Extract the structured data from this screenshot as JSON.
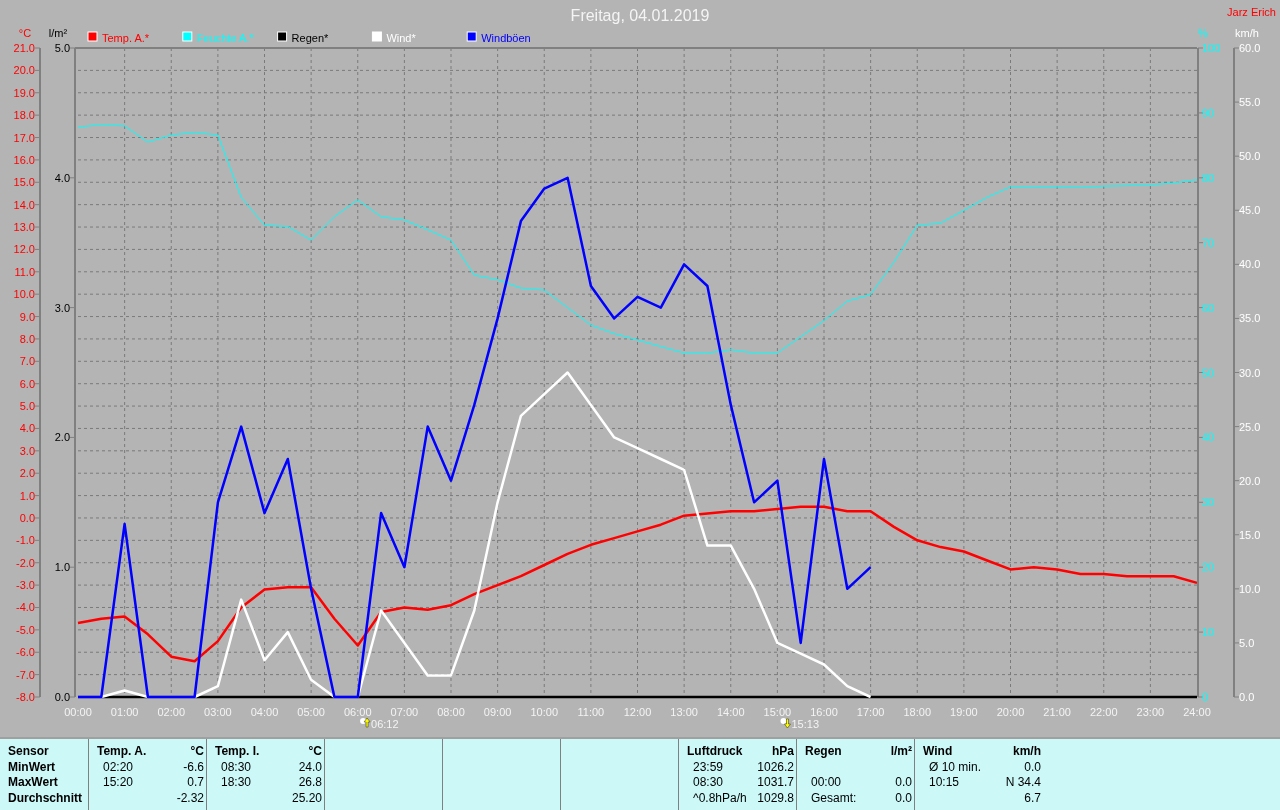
{
  "header": {
    "title": "Freitag, 04.01.2019",
    "author": "Jarz Erich"
  },
  "charts": [
    {
      "chart_data": {
        "type": "line",
        "ylabel": "°C",
        "legend": "top",
        "grid": true,
        "xlim": [
          0,
          24
        ],
        "ylim": [
          -8,
          21
        ],
        "x": [
          0,
          0.5,
          1,
          1.5,
          2,
          2.5,
          3,
          3.5,
          4,
          4.5,
          5,
          5.5,
          6,
          6.5,
          7,
          7.5,
          8,
          8.5,
          9,
          9.5,
          10,
          10.5,
          11,
          11.5,
          12,
          12.5,
          13,
          13.5,
          14,
          14.5,
          15,
          15.5,
          16,
          16.5,
          17,
          17.5,
          18,
          18.5,
          19,
          19.5,
          20,
          20.5,
          21,
          21.5,
          22,
          22.5,
          23,
          23.5,
          24
        ],
        "xticks": [
          {
            "value": 0,
            "label": "00:00"
          },
          {
            "value": 1,
            "label": "01:00"
          },
          {
            "value": 2,
            "label": "02:00"
          },
          {
            "value": 3,
            "label": "03:00"
          },
          {
            "value": 4,
            "label": "04:00"
          },
          {
            "value": 5,
            "label": "05:00"
          },
          {
            "value": 6,
            "label": "06:00"
          },
          {
            "value": 7,
            "label": "07:00"
          },
          {
            "value": 8,
            "label": "08:00"
          },
          {
            "value": 9,
            "label": "09:00"
          },
          {
            "value": 10,
            "label": "10:00"
          },
          {
            "value": 11,
            "label": "11:00"
          },
          {
            "value": 12,
            "label": "12:00"
          },
          {
            "value": 13,
            "label": "13:00"
          },
          {
            "value": 14,
            "label": "14:00"
          },
          {
            "value": 15,
            "label": "15:00"
          },
          {
            "value": 16,
            "label": "16:00"
          },
          {
            "value": 17,
            "label": "17:00"
          },
          {
            "value": 18,
            "label": "18:00"
          },
          {
            "value": 19,
            "label": "19:00"
          },
          {
            "value": 20,
            "label": "20:00"
          },
          {
            "value": 21,
            "label": "21:00"
          },
          {
            "value": 22,
            "label": "22:00"
          },
          {
            "value": 23,
            "label": "23:00"
          },
          {
            "value": 24,
            "label": "24:00"
          }
        ],
        "yticks": [
          {
            "value": 21,
            "label": "21.0"
          },
          {
            "value": 20,
            "label": "20.0"
          },
          {
            "value": 19,
            "label": "19.0"
          },
          {
            "value": 18,
            "label": "18.0"
          },
          {
            "value": 17,
            "label": "17.0"
          },
          {
            "value": 16,
            "label": "16.0"
          },
          {
            "value": 15,
            "label": "15.0"
          },
          {
            "value": 14,
            "label": "14.0"
          },
          {
            "value": 13,
            "label": "13.0"
          },
          {
            "value": 12,
            "label": "12.0"
          },
          {
            "value": 11,
            "label": "11.0"
          },
          {
            "value": 10,
            "label": "10.0"
          },
          {
            "value": 9,
            "label": "9.0"
          },
          {
            "value": 8,
            "label": "8.0"
          },
          {
            "value": 7,
            "label": "7.0"
          },
          {
            "value": 6,
            "label": "6.0"
          },
          {
            "value": 5,
            "label": "5.0"
          },
          {
            "value": 4,
            "label": "4.0"
          },
          {
            "value": 3,
            "label": "3.0"
          },
          {
            "value": 2,
            "label": "2.0"
          },
          {
            "value": 1,
            "label": "1.0"
          },
          {
            "value": 0,
            "label": "0.0"
          },
          {
            "value": -1,
            "label": "-1.0"
          },
          {
            "value": -2,
            "label": "-2.0"
          },
          {
            "value": -3,
            "label": "-3.0"
          },
          {
            "value": -4,
            "label": "-4.0"
          },
          {
            "value": -5,
            "label": "-5.0"
          },
          {
            "value": -6,
            "label": "-6.0"
          },
          {
            "value": -7,
            "label": "-7.0"
          },
          {
            "value": -8,
            "label": "-8.0"
          }
        ],
        "series": [
          {
            "name": "Temp. A.*",
            "color": "#ff0000",
            "values": [
              -4.7,
              -4.5,
              -4.4,
              -5.2,
              -6.2,
              -6.4,
              -5.5,
              -4,
              -3.2,
              -3.1,
              -3.1,
              -4.5,
              -5.7,
              -4.2,
              -4,
              -4.1,
              -3.9,
              -3.4,
              -3,
              -2.6,
              -2.1,
              -1.6,
              -1.2,
              -0.9,
              -0.6,
              -0.3,
              0.1,
              0.2,
              0.3,
              0.3,
              0.4,
              0.5,
              0.5,
              0.3,
              0.3,
              -0.4,
              -1,
              -1.3,
              -1.5,
              -1.9,
              -2.3,
              -2.2,
              -2.3,
              -2.5,
              -2.5,
              -2.6,
              -2.6,
              -2.6,
              -2.9
            ]
          }
        ]
      },
      "sun_events": [
        {
          "kind": "sunrise",
          "time": "06:12"
        },
        {
          "kind": "sunset",
          "time": "15:13"
        }
      ]
    },
    {
      "chart_data": {
        "type": "line",
        "ylabel": "%",
        "legend": "top",
        "xlim": [
          0,
          24
        ],
        "ylim": [
          0,
          100
        ],
        "x": [
          0,
          0.5,
          1,
          1.5,
          2,
          2.5,
          3,
          3.5,
          4,
          4.5,
          5,
          5.5,
          6,
          6.5,
          7,
          7.5,
          8,
          8.5,
          9,
          9.5,
          10,
          10.5,
          11,
          11.5,
          12,
          12.5,
          13,
          13.5,
          14,
          14.5,
          15,
          15.5,
          16,
          16.5,
          17,
          17.5,
          18,
          18.5,
          19,
          19.5,
          20,
          20.5,
          21,
          21.5,
          22,
          22.5,
          23,
          23.5,
          24
        ],
        "yticks": [
          {
            "value": 100,
            "label": "100"
          },
          {
            "value": 90,
            "label": "90"
          },
          {
            "value": 80,
            "label": "80"
          },
          {
            "value": 70,
            "label": "70"
          },
          {
            "value": 60,
            "label": "60"
          },
          {
            "value": 50,
            "label": "50"
          },
          {
            "value": 40,
            "label": "40"
          },
          {
            "value": 30,
            "label": "30"
          },
          {
            "value": 20,
            "label": "20"
          },
          {
            "value": 10,
            "label": "10"
          },
          {
            "value": 0,
            "label": "0"
          }
        ],
        "series": [
          {
            "name": "Feuchte A.*",
            "color": "#00ffff",
            "values": [
              87.8,
              88.2,
              88,
              85.5,
              86.6,
              87,
              86.6,
              77,
              72.7,
              72.5,
              70.4,
              74,
              76.6,
              74,
              73.5,
              72,
              70.4,
              65,
              64.3,
              63,
              62.7,
              60,
              57.3,
              56,
              55,
              54,
              53,
              53,
              53.5,
              53,
              53,
              55.5,
              58,
              61,
              62,
              67,
              72.7,
              73,
              75,
              77,
              78.6,
              78.5,
              78.6,
              78.5,
              78.7,
              78.8,
              78.9,
              79.2,
              79.7
            ]
          }
        ]
      }
    },
    {
      "chart_data": {
        "type": "line",
        "ylabel": "l/m²",
        "legend": "top",
        "xlim": [
          0,
          24
        ],
        "ylim": [
          0,
          5
        ],
        "x": [
          0,
          0.5,
          1,
          1.5,
          2,
          2.5,
          3,
          3.5,
          4,
          4.5,
          5,
          5.5,
          6,
          6.5,
          7,
          7.5,
          8,
          8.5,
          9,
          9.5,
          10,
          10.5,
          11,
          11.5,
          12,
          12.5,
          13,
          13.5,
          14,
          14.5,
          15,
          15.5,
          16,
          16.5,
          17,
          17.5,
          18,
          18.5,
          19,
          19.5,
          20,
          20.5,
          21,
          21.5,
          22,
          22.5,
          23,
          23.5,
          24
        ],
        "yticks": [
          {
            "value": 5,
            "label": "5.0"
          },
          {
            "value": 4,
            "label": "4.0"
          },
          {
            "value": 3,
            "label": "3.0"
          },
          {
            "value": 2,
            "label": "2.0"
          },
          {
            "value": 1,
            "label": "1.0"
          },
          {
            "value": 0,
            "label": "0.0"
          }
        ],
        "series": [
          {
            "name": "Regen*",
            "color": "#000000",
            "values": [
              0,
              0,
              0,
              0,
              0,
              0,
              0,
              0,
              0,
              0,
              0,
              0,
              0,
              0,
              0,
              0,
              0,
              0,
              0,
              0,
              0,
              0,
              0,
              0,
              0,
              0,
              0,
              0,
              0,
              0,
              0,
              0,
              0,
              0,
              0,
              0,
              0,
              0,
              0,
              0,
              0,
              0,
              0,
              0,
              0,
              0,
              0,
              0,
              0
            ]
          }
        ]
      }
    },
    {
      "chart_data": {
        "type": "line",
        "ylabel": "km/h",
        "legend": "top",
        "xlim": [
          0,
          24
        ],
        "ylim": [
          0,
          60
        ],
        "x": [
          0,
          0.5,
          1,
          1.5,
          2,
          2.5,
          3,
          3.5,
          4,
          4.5,
          5,
          5.5,
          6,
          6.5,
          7,
          7.5,
          8,
          8.5,
          9,
          9.5,
          10,
          10.5,
          11,
          11.5,
          12,
          12.5,
          13,
          13.5,
          14,
          14.5,
          15,
          15.5,
          16,
          16.5,
          17
        ],
        "yticks": [
          {
            "value": 60,
            "label": "60.0"
          },
          {
            "value": 55,
            "label": "55.0"
          },
          {
            "value": 50,
            "label": "50.0"
          },
          {
            "value": 45,
            "label": "45.0"
          },
          {
            "value": 40,
            "label": "40.0"
          },
          {
            "value": 35,
            "label": "35.0"
          },
          {
            "value": 30,
            "label": "30.0"
          },
          {
            "value": 25,
            "label": "25.0"
          },
          {
            "value": 20,
            "label": "20.0"
          },
          {
            "value": 15,
            "label": "15.0"
          },
          {
            "value": 10,
            "label": "10.0"
          },
          {
            "value": 5,
            "label": "5.0"
          },
          {
            "value": 0,
            "label": "0.0"
          }
        ],
        "series": [
          {
            "name": "Wind*",
            "color": "#ffffff",
            "values": [
              0,
              0,
              0.6,
              0,
              0,
              0,
              1,
              9,
              3.4,
              6,
              1.6,
              0,
              0,
              8,
              5,
              2,
              2,
              8,
              18,
              26,
              28,
              30,
              27,
              24,
              23,
              22,
              21,
              14,
              14,
              10,
              5,
              4,
              3,
              1,
              0
            ]
          },
          {
            "name": "Windböen",
            "color": "#0000ff",
            "values": [
              0,
              0,
              16,
              0,
              0,
              0,
              18,
              25,
              17,
              22,
              10,
              0,
              0,
              17,
              12,
              25,
              20,
              27,
              35,
              44,
              47,
              48,
              38,
              35,
              37,
              36,
              40,
              38,
              27,
              18,
              20,
              5,
              22,
              10,
              12
            ]
          }
        ]
      }
    }
  ],
  "stats_table": {
    "corner": "Sensor",
    "row_labels": [
      "MinWert",
      "MaxWert",
      "Durchschnitt"
    ],
    "groups": [
      {
        "kind": "data",
        "name": "Temp. A.",
        "unit": "°C",
        "rows": [
          [
            "02:20",
            "-6.6"
          ],
          [
            "15:20",
            "0.7"
          ],
          [
            null,
            "-2.32"
          ]
        ]
      },
      {
        "kind": "data",
        "name": "Temp. I.",
        "unit": "°C",
        "rows": [
          [
            "08:30",
            "24.0"
          ],
          [
            "18:30",
            "26.8"
          ],
          [
            null,
            "25.20"
          ]
        ]
      },
      {
        "kind": "blank"
      },
      {
        "kind": "blank"
      },
      {
        "kind": "blank"
      },
      {
        "kind": "data",
        "name": "Luftdruck",
        "unit": "hPa",
        "rows": [
          [
            "23:59",
            "1026.2"
          ],
          [
            "08:30",
            "1031.7"
          ],
          [
            "^0.8hPa/h",
            "1029.8"
          ]
        ]
      },
      {
        "kind": "data",
        "name": "Regen",
        "unit": "l/m²",
        "rows": [
          [
            null,
            null
          ],
          [
            "00:00",
            "0.0"
          ],
          [
            "Gesamt:",
            "0.0"
          ]
        ]
      },
      {
        "kind": "data",
        "name": "Wind",
        "unit": "km/h",
        "rows": [
          [
            "Ø 10 min.",
            "0.0"
          ],
          [
            "10:15",
            "N 34.4"
          ],
          [
            null,
            "6.7"
          ]
        ]
      }
    ]
  }
}
